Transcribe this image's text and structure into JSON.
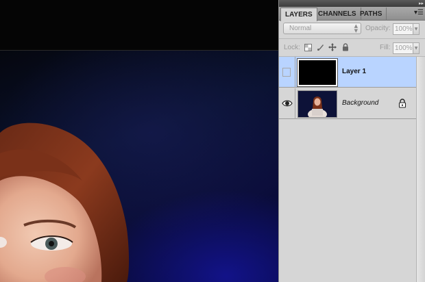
{
  "panel": {
    "tabs": [
      {
        "label": "LAYERS",
        "active": true
      },
      {
        "label": "CHANNELS",
        "active": false
      },
      {
        "label": "PATHS",
        "active": false
      }
    ],
    "blend_mode": "Normal",
    "opacity_label": "Opacity:",
    "opacity_value": "100%",
    "lock_label": "Lock:",
    "fill_label": "Fill:",
    "fill_value": "100%",
    "icons": {
      "collapse": "double-arrow-right-icon",
      "panel_menu": "panel-menu-icon",
      "lock_transparent": "lock-transparent-pixels-icon",
      "lock_image": "brush-icon",
      "lock_position": "move-icon",
      "lock_all": "lock-icon",
      "visibility": "eye-icon"
    }
  },
  "layers": [
    {
      "name": "Layer 1",
      "selected": true,
      "visible": false,
      "style": "bold",
      "thumbnail": "black"
    },
    {
      "name": "Background",
      "selected": false,
      "visible": true,
      "style": "italic",
      "locked": true,
      "thumbnail": "photo"
    }
  ],
  "colors": {
    "selection": "#b9d4ff",
    "panel_bg": "#d6d6d6",
    "canvas_bg": "#050505",
    "photo_blue": "#0b0d3a"
  }
}
